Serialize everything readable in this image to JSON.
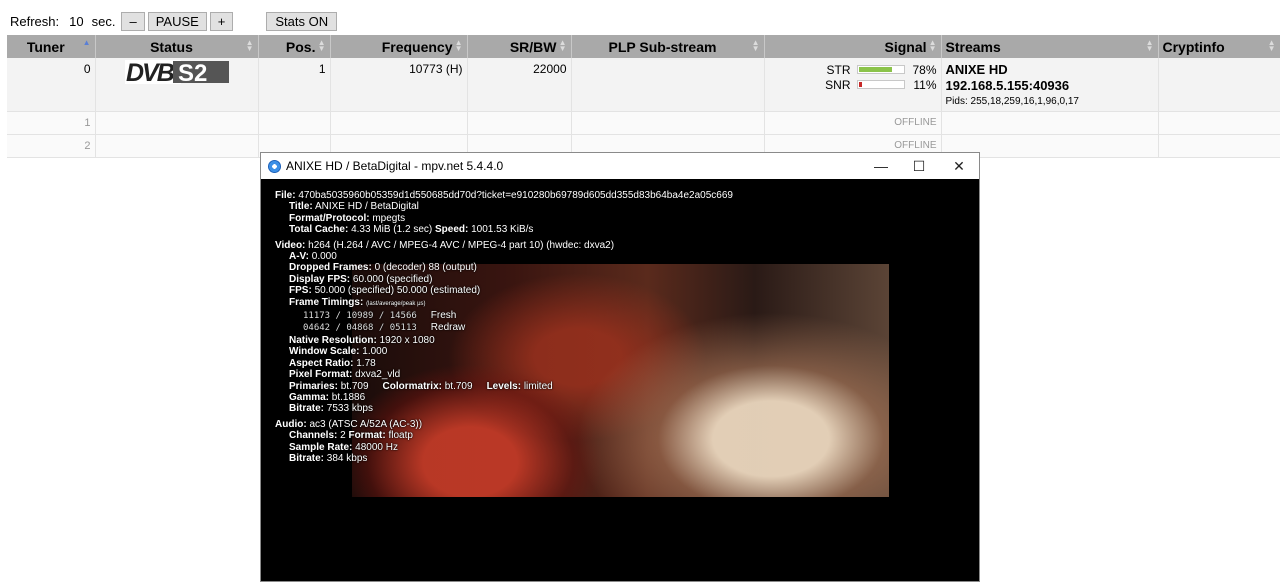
{
  "controls": {
    "refresh_label": "Refresh:",
    "refresh_value": "10",
    "refresh_unit": "sec.",
    "minus_label": "–",
    "pause_label": "PAUSE",
    "plus_label": "+",
    "stats_label": "Stats ON"
  },
  "table": {
    "headers": {
      "tuner": "Tuner",
      "status": "Status",
      "pos": "Pos.",
      "frequency": "Frequency",
      "srbw": "SR/BW",
      "plp": "PLP Sub-stream",
      "signal": "Signal",
      "streams": "Streams",
      "cryptinfo": "Cryptinfo"
    },
    "rows": [
      {
        "tuner": "0",
        "status_logo_a": "DVB",
        "status_logo_b": "S2",
        "pos": "1",
        "frequency": "10773 (H)",
        "srbw": "22000",
        "str_label": "STR",
        "str_pct": "78%",
        "str_value": 78,
        "snr_label": "SNR",
        "snr_pct": "11%",
        "snr_value": 11,
        "stream_name": "ANIXE HD",
        "stream_addr": "192.168.5.155:40936",
        "stream_pids": "Pids: 255,18,259,16,1,96,0,17"
      },
      {
        "tuner": "1",
        "signal": "OFFLINE"
      },
      {
        "tuner": "2",
        "signal": "OFFLINE"
      }
    ],
    "colors": {
      "str_fill": "#8bc34a",
      "snr_fill": "#c62828",
      "header_bg": "#a9a9a9"
    }
  },
  "mpv": {
    "title": "ANIXE HD / BetaDigital - mpv.net 5.4.4.0",
    "stats": {
      "file_k": "File:",
      "file_v": "470ba5035960b05359d1d550685dd70d?ticket=e910280b69789d605dd355d83b64ba4e2a05c669",
      "title_k": "Title:",
      "title_v": "ANIXE HD / BetaDigital",
      "format_k": "Format/Protocol:",
      "format_v": "mpegts",
      "cache_k": "Total Cache:",
      "cache_v": "4.33 MiB (1.2 sec)",
      "speed_k": "Speed:",
      "speed_v": "1001.53 KiB/s",
      "video_k": "Video:",
      "video_v": "h264 (H.264 / AVC / MPEG-4 AVC / MPEG-4 part 10) (hwdec: dxva2)",
      "av_k": "A-V:",
      "av_v": "0.000",
      "dropped_k": "Dropped Frames:",
      "dropped_v": "0 (decoder) 88 (output)",
      "dfps_k": "Display FPS:",
      "dfps_v": "60.000 (specified)",
      "fps_k": "FPS:",
      "fps_v": "50.000 (specified) 50.000 (estimated)",
      "ft_k": "Frame Timings:",
      "ft_hint": "(last/average/peak μs)",
      "ft1_v": "11173 / 10989 / 14566",
      "ft1_l": "Fresh",
      "ft2_v": "04642 / 04868 / 05113",
      "ft2_l": "Redraw",
      "res_k": "Native Resolution:",
      "res_v": "1920 x 1080",
      "ws_k": "Window Scale:",
      "ws_v": "1.000",
      "ar_k": "Aspect Ratio:",
      "ar_v": "1.78",
      "pf_k": "Pixel Format:",
      "pf_v": "dxva2_vld",
      "prim_k": "Primaries:",
      "prim_v": "bt.709",
      "cm_k": "Colormatrix:",
      "cm_v": "bt.709",
      "lv_k": "Levels:",
      "lv_v": "limited",
      "gamma_k": "Gamma:",
      "gamma_v": "bt.1886",
      "vbr_k": "Bitrate:",
      "vbr_v": "7533 kbps",
      "audio_k": "Audio:",
      "audio_v": "ac3 (ATSC A/52A (AC-3))",
      "ch_k": "Channels:",
      "ch_v": "2",
      "af_k": "Format:",
      "af_v": "floatp",
      "sr_k": "Sample Rate:",
      "sr_v": "48000 Hz",
      "abr_k": "Bitrate:",
      "abr_v": "384 kbps"
    }
  }
}
